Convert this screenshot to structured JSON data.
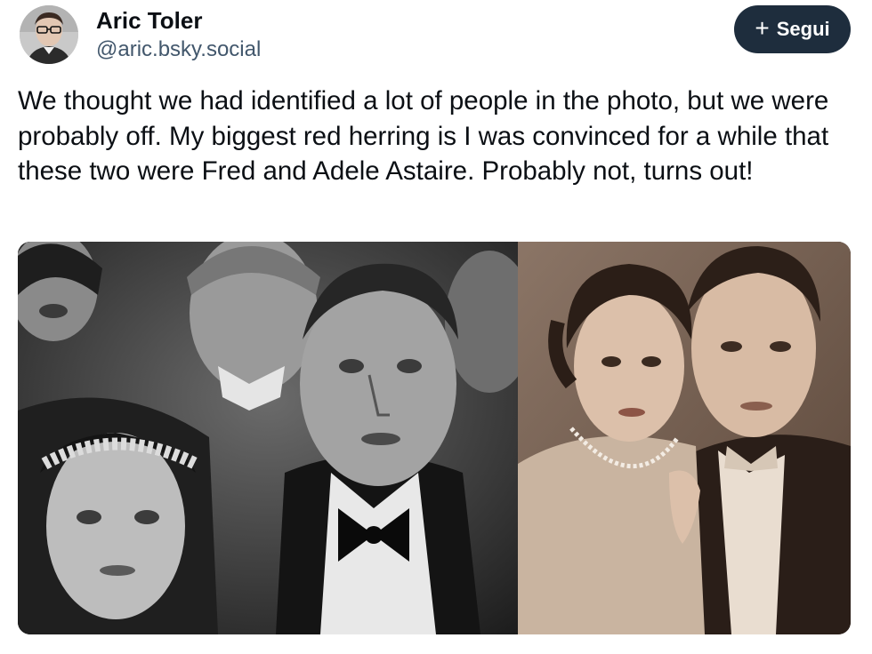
{
  "author": {
    "display_name": "Aric Toler",
    "handle": "@aric.bsky.social"
  },
  "follow_button": {
    "icon": "plus-icon",
    "label": "Segui"
  },
  "post": {
    "text": "We thought we had identified a lot of people in the photo, but we were probably off. My biggest red herring is I was convinced for a while that these two were Fred and Adele Astaire. Probably not, turns out!"
  },
  "media": {
    "images": [
      {
        "tone": "black-and-white",
        "subject": "crop of a crowded group photo: a man in a tuxedo and bow tie beside a woman in a jeweled headband"
      },
      {
        "tone": "sepia",
        "subject": "studio portrait of a woman with a pearl necklace and a man in a suit with a polka-dot bow tie"
      }
    ]
  },
  "colors": {
    "text": "#0b0f14",
    "handle": "#42576c",
    "button_bg": "#1e2d3d",
    "button_text": "#ffffff"
  }
}
